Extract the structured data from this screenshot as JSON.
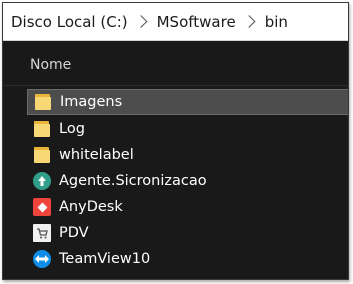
{
  "breadcrumb": [
    "Disco Local (C:)",
    "MSoftware",
    "bin"
  ],
  "columns": {
    "name": "Nome"
  },
  "files": [
    {
      "label": "Imagens",
      "icon": "folder-icon",
      "selected": true
    },
    {
      "label": "Log",
      "icon": "folder-icon",
      "selected": false
    },
    {
      "label": "whitelabel",
      "icon": "folder-icon",
      "selected": false
    },
    {
      "label": "Agente.Sicronizacao",
      "icon": "agente-app-icon",
      "selected": false
    },
    {
      "label": "AnyDesk",
      "icon": "anydesk-icon",
      "selected": false
    },
    {
      "label": "PDV",
      "icon": "pdv-app-icon",
      "selected": false
    },
    {
      "label": "TeamView10",
      "icon": "teamviewer-icon",
      "selected": false
    }
  ],
  "colors": {
    "background": "#191919",
    "selection": "#4d4d4d",
    "folder": "#f8d775",
    "anydesk": "#ef443b",
    "teamviewer": "#0e8ee9",
    "agente": "#2f9e8a"
  }
}
